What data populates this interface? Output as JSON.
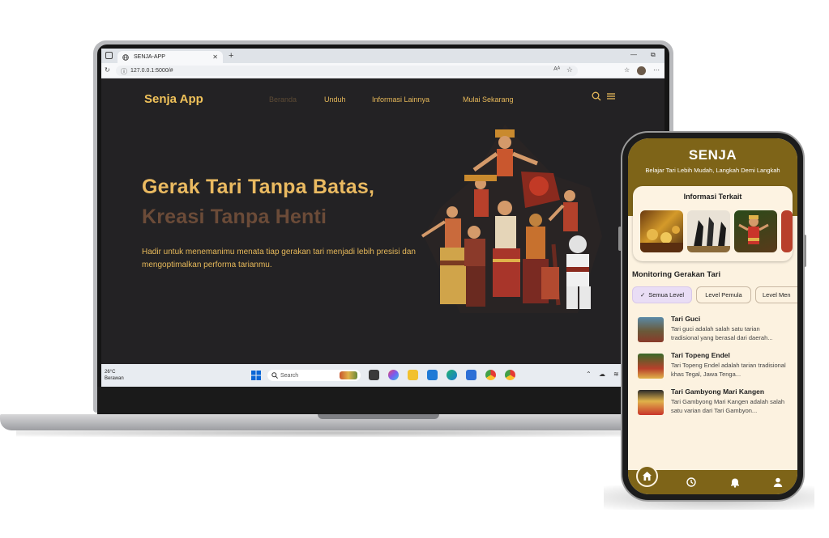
{
  "browser": {
    "tab_title": "SENJA-APP",
    "tab_close": "✕",
    "new_tab": "+",
    "url": "127.0.0.1:5000/#",
    "min": "—",
    "restore": "⧉"
  },
  "website": {
    "brand": "Senja App",
    "nav": [
      "Beranda",
      "Unduh",
      "Informasi Lainnya",
      "Mulai Sekarang"
    ],
    "hero_line1": "Gerak Tari Tanpa Batas,",
    "hero_line2": "Kreasi Tanpa Henti",
    "hero_text": "Hadir untuk menemanimu menata tiap gerakan tari menjadi lebih presisi dan mengoptimalkan performa tarianmu."
  },
  "taskbar": {
    "temperature": "26°C",
    "weather": "Berawan",
    "search_placeholder": "Search"
  },
  "phone": {
    "title": "SENJA",
    "subtitle": "Belajar Tari Lebih Mudah, Langkah Demi Langkah",
    "info_title": "Informasi Terkait",
    "monitoring_title": "Monitoring Gerakan Tari",
    "chips": [
      "Semua Level",
      "Level Pemula",
      "Level Men"
    ],
    "selected_chip_mark": "✓",
    "dances": [
      {
        "title": "Tari Guci",
        "desc": "Tari guci adalah salah satu tarian tradisional yang berasal dari daerah..."
      },
      {
        "title": "Tari Topeng Endel",
        "desc": "Tari Topeng Endel adalah tarian tradisional khas Tegal, Jawa Tenga..."
      },
      {
        "title": "Tari Gambyong Mari Kangen",
        "desc": "Tari Gambyong Mari Kangen adalah salah satu varian dari Tari Gambyon..."
      }
    ],
    "nav_icons": [
      "home-icon",
      "history-icon",
      "bell-icon",
      "person-icon"
    ]
  },
  "colors": {
    "site_bg": "#232224",
    "gold": "#eaba61",
    "brown": "#6b4b38",
    "phone_header": "#7e6418",
    "phone_bg": "#fcf2e0"
  }
}
